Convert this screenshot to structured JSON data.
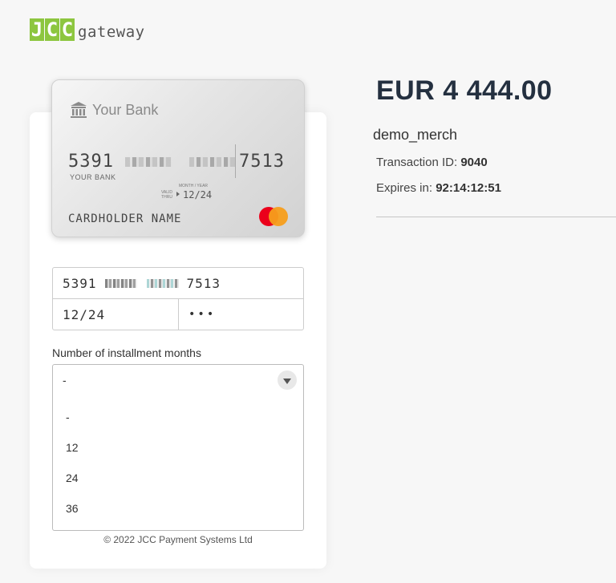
{
  "logo": {
    "letters": [
      "J",
      "C",
      "C"
    ],
    "word": "gateway",
    "brand_color": "#8dc63f"
  },
  "card": {
    "bank_name": "Your Bank",
    "bank_icon": "bank-icon",
    "number_first": "5391",
    "number_last": "7513",
    "bank_sub": "YOUR BANK",
    "valid_thru_label": "VALID THRU",
    "month_year_label": "MONTH / YEAR",
    "expiry": "12/24",
    "holder": "CARDHOLDER NAME",
    "network_icon": "mastercard-icon"
  },
  "form": {
    "card_number_first": "5391",
    "card_number_last": "7513",
    "expiry_value": "12/24",
    "cvv_value": "•••",
    "installments_label": "Number of installment months",
    "installments_selected": "-",
    "installments_options": [
      "-",
      "12",
      "24",
      "36"
    ]
  },
  "footer": {
    "copyright": "© 2022 JCC Payment Systems Ltd"
  },
  "summary": {
    "amount": "EUR 4 444.00",
    "merchant": "demo_merch",
    "transaction_label": "Transaction ID: ",
    "transaction_id": "9040",
    "expires_label": "Expires in: ",
    "expires_value": "92:14:12:51"
  }
}
